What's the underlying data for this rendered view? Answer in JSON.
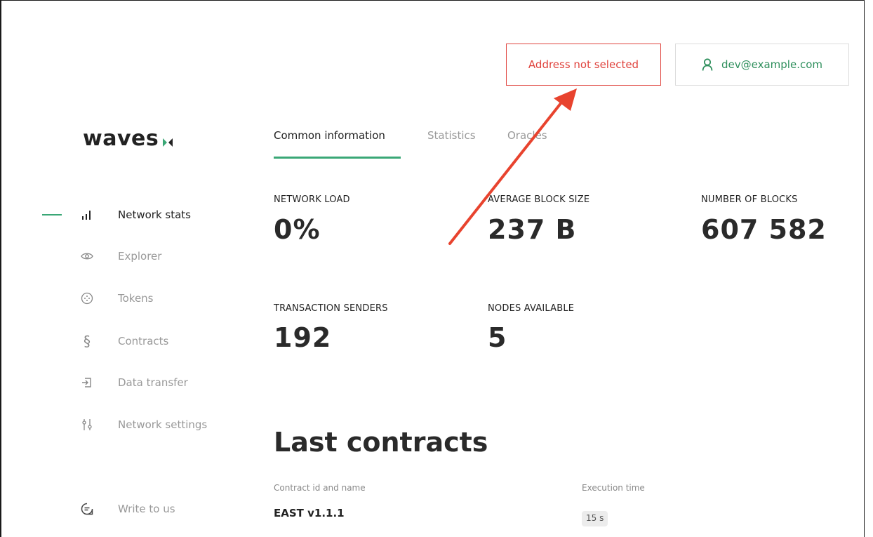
{
  "header": {
    "address_button": "Address not selected",
    "user_email": "dev@example.com"
  },
  "logo": {
    "text": "waves"
  },
  "sidebar": {
    "items": [
      {
        "label": "Network stats",
        "icon": "bar-chart-icon",
        "active": true
      },
      {
        "label": "Explorer",
        "icon": "eye-icon",
        "active": false
      },
      {
        "label": "Tokens",
        "icon": "token-icon",
        "active": false
      },
      {
        "label": "Contracts",
        "icon": "section-icon",
        "active": false
      },
      {
        "label": "Data transfer",
        "icon": "transfer-icon",
        "active": false
      },
      {
        "label": "Network settings",
        "icon": "sliders-icon",
        "active": false
      }
    ],
    "footer": {
      "label": "Write to us",
      "icon": "chat-icon"
    }
  },
  "tabs": [
    {
      "label": "Common information",
      "active": true
    },
    {
      "label": "Statistics",
      "active": false
    },
    {
      "label": "Oracles",
      "active": false
    }
  ],
  "stats": [
    {
      "label": "NETWORK LOAD",
      "value": "0%"
    },
    {
      "label": "AVERAGE BLOCK SIZE",
      "value": "237 B"
    },
    {
      "label": "NUMBER OF BLOCKS",
      "value": "607 582"
    },
    {
      "label": "TRANSACTION SENDERS",
      "value": "192"
    },
    {
      "label": "NODES AVAILABLE",
      "value": "5"
    }
  ],
  "last_contracts": {
    "title": "Last contracts",
    "columns": [
      "Contract id and name",
      "Execution time"
    ],
    "rows": [
      {
        "name": "EAST v1.1.1",
        "execution_time": "15 s"
      }
    ]
  },
  "colors": {
    "accent": "#3aa776",
    "error": "#e0443e",
    "annotation_arrow": "#e8432e"
  }
}
